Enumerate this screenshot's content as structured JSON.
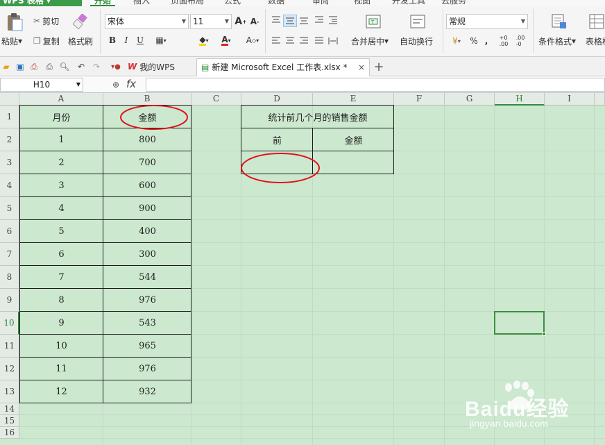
{
  "app": {
    "title": "WPS 表格"
  },
  "menu_tabs": [
    {
      "label": "开始",
      "active": true
    },
    {
      "label": "插入"
    },
    {
      "label": "页面布局"
    },
    {
      "label": "公式"
    },
    {
      "label": "数据"
    },
    {
      "label": "审阅"
    },
    {
      "label": "视图"
    },
    {
      "label": "开发工具"
    },
    {
      "label": "云服务"
    }
  ],
  "ribbon": {
    "paste": "粘贴",
    "cut": "剪切",
    "copy": "复制",
    "format_painter": "格式刷",
    "font_name": "宋体",
    "font_size": "11",
    "merge_center": "合并居中",
    "auto_wrap": "自动换行",
    "number_format": "常规",
    "percent": "%",
    "conditional_format": "条件格式",
    "table_format": "表格样"
  },
  "toolbar": {
    "my_wps": "我的WPS",
    "doc_tab": "新建 Microsoft Excel 工作表.xlsx *",
    "close": "×",
    "new_tab": "+"
  },
  "formula_bar": {
    "cell_ref": "H10",
    "fx": "fx",
    "formula": ""
  },
  "columns": [
    "A",
    "B",
    "C",
    "D",
    "E",
    "F",
    "G",
    "H",
    "I"
  ],
  "selected_column": "H",
  "selected_row": "10",
  "rows": [
    "1",
    "2",
    "3",
    "4",
    "5",
    "6",
    "7",
    "8",
    "9",
    "10",
    "11",
    "12",
    "13",
    "14",
    "15",
    "16"
  ],
  "sheet": {
    "header_month": "月份",
    "header_amount": "金额",
    "months": [
      "1",
      "2",
      "3",
      "4",
      "5",
      "6",
      "7",
      "8",
      "9",
      "10",
      "11",
      "12"
    ],
    "amounts": [
      "800",
      "700",
      "600",
      "900",
      "400",
      "300",
      "544",
      "976",
      "543",
      "965",
      "976",
      "932"
    ],
    "summary_title": "统计前几个月的销售金额",
    "summary_front": "前",
    "summary_amount": "金额"
  },
  "watermark": {
    "brand": "Baidu经验",
    "url": "jingyan.baidu.com"
  },
  "colors": {
    "accent": "#2e8b3d",
    "sheet_bg": "#cce8cf",
    "annotation": "#e0141e"
  }
}
